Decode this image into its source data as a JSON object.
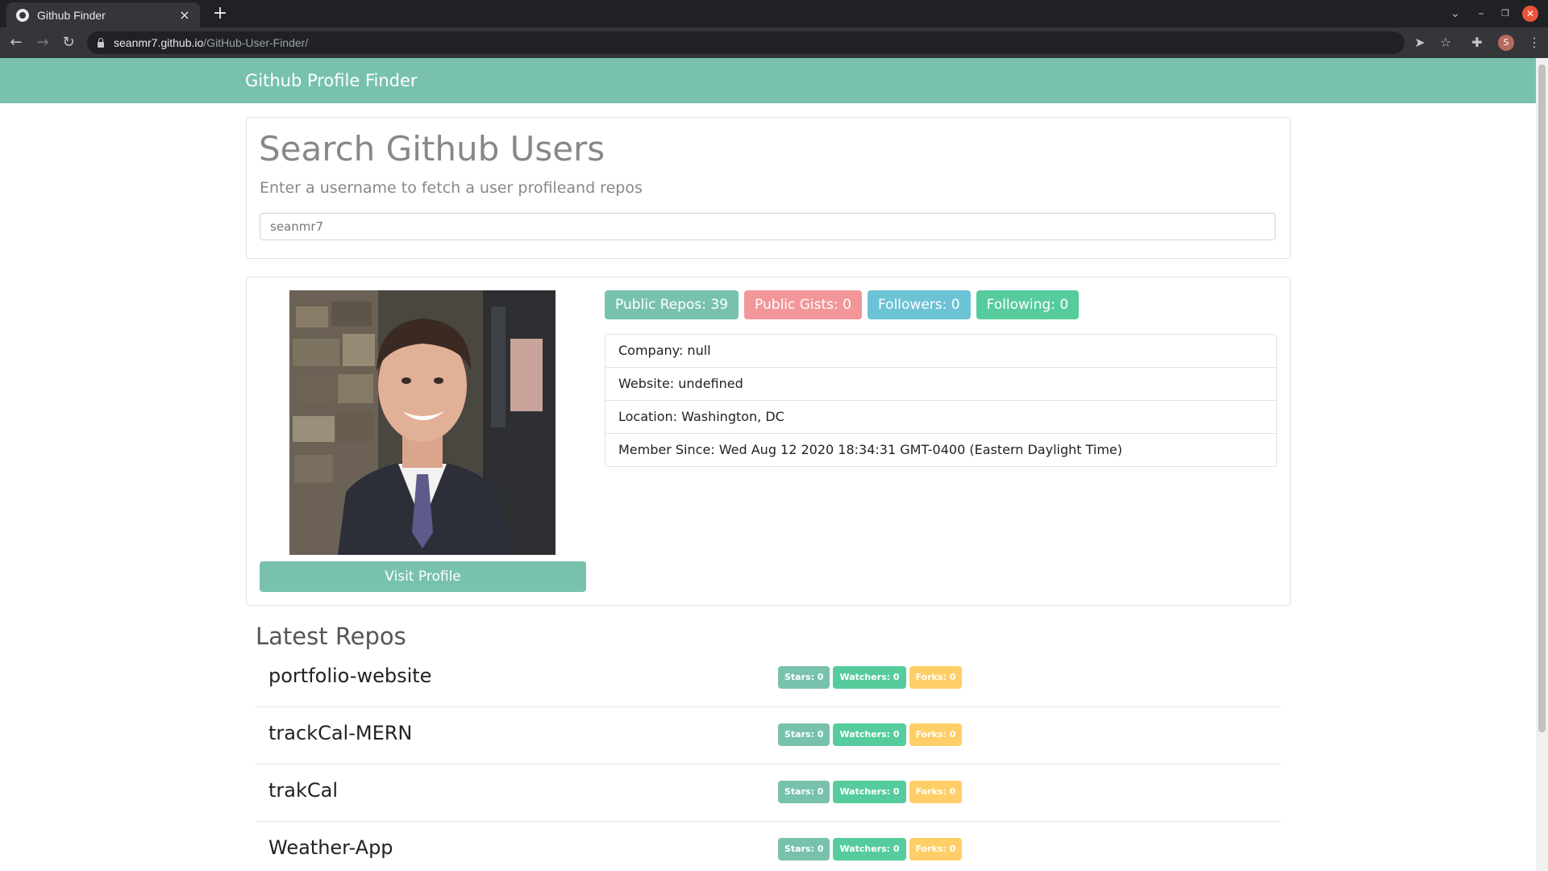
{
  "browser": {
    "tab_title": "Github Finder",
    "tab_close": "×",
    "new_tab": "+",
    "url_host": "seanmr7.github.io",
    "url_path": "/GitHub-User-Finder/",
    "profile_initial": "S",
    "icons": [
      "back-icon",
      "forward-icon",
      "reload-icon",
      "lock-icon",
      "send-icon",
      "star-icon",
      "extensions-icon",
      "menu-icon",
      "tab-search-icon",
      "minimize-icon",
      "restore-icon",
      "close-icon"
    ]
  },
  "navbar": {
    "brand": "Github Profile Finder",
    "color": "#78c2ad"
  },
  "search": {
    "title": "Search Github Users",
    "subtitle": "Enter a username to fetch a user profileand repos",
    "value": "seanmr7"
  },
  "profile": {
    "visit_label": "Visit Profile",
    "badges": [
      {
        "label": "Public Repos: 39",
        "color": "#78c2ad"
      },
      {
        "label": "Public Gists: 0",
        "color": "#f3969a"
      },
      {
        "label": "Followers: 0",
        "color": "#6cc3d5"
      },
      {
        "label": "Following: 0",
        "color": "#56cc9d"
      }
    ],
    "info": [
      "Company: null",
      "Website: undefined",
      "Location: Washington, DC",
      "Member Since: Wed Aug 12 2020 18:34:31 GMT-0400 (Eastern Daylight Time)"
    ]
  },
  "repos": {
    "title": "Latest Repos",
    "items": [
      {
        "name": "portfolio-website",
        "stars": "Stars: 0",
        "watchers": "Watchers: 0",
        "forks": "Forks: 0"
      },
      {
        "name": "trackCal-MERN",
        "stars": "Stars: 0",
        "watchers": "Watchers: 0",
        "forks": "Forks: 0"
      },
      {
        "name": "trakCal",
        "stars": "Stars: 0",
        "watchers": "Watchers: 0",
        "forks": "Forks: 0"
      },
      {
        "name": "Weather-App",
        "stars": "Stars: 0",
        "watchers": "Watchers: 0",
        "forks": "Forks: 0"
      }
    ],
    "colors": {
      "stars": "#78c2ad",
      "watchers": "#56cc9d",
      "forks": "#ffce67"
    }
  }
}
